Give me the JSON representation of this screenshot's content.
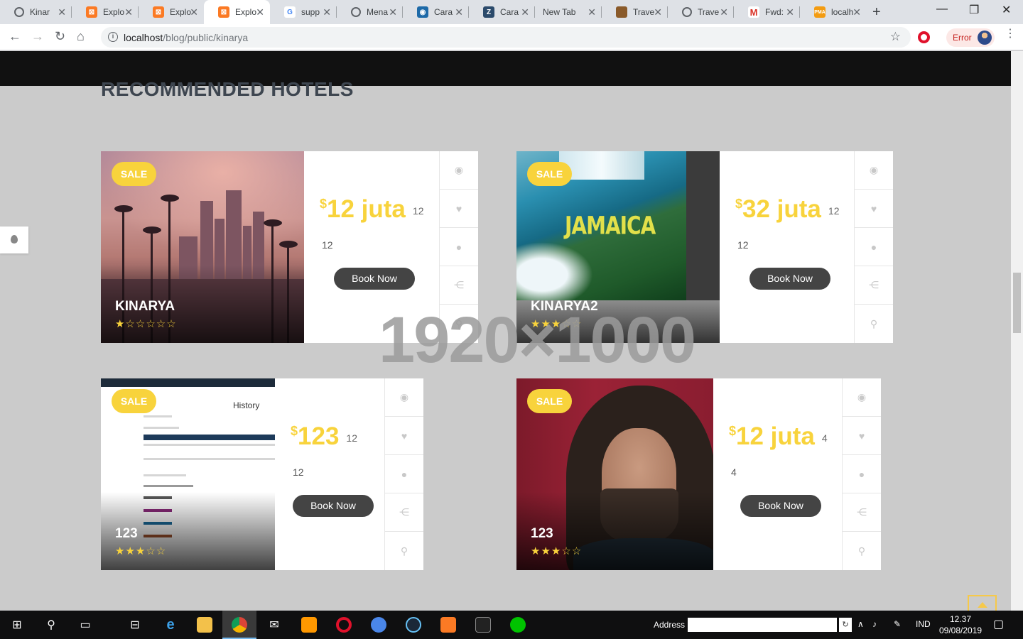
{
  "browser": {
    "tabs": [
      {
        "title": "Kinar",
        "icon": "globe-icon",
        "color": "#5f6368"
      },
      {
        "title": "Explo",
        "icon": "xampp-icon",
        "color": "#fb7a24"
      },
      {
        "title": "Explo",
        "icon": "xampp-icon",
        "color": "#fb7a24"
      },
      {
        "title": "Explo",
        "icon": "xampp-icon",
        "color": "#fb7a24",
        "active": true
      },
      {
        "title": "supp",
        "icon": "google-icon",
        "color": "#4285f4"
      },
      {
        "title": "Mena",
        "icon": "globe-icon",
        "color": "#5f6368"
      },
      {
        "title": "Cara",
        "icon": "db-icon",
        "color": "#1e6aa8"
      },
      {
        "title": "Cara",
        "icon": "zeplin-icon",
        "color": "#2b4a6b"
      },
      {
        "title": "New Tab",
        "icon": "",
        "color": ""
      },
      {
        "title": "Trave",
        "icon": "photo-icon",
        "color": "#8a5a2a"
      },
      {
        "title": "Trave",
        "icon": "globe-icon",
        "color": "#5f6368"
      },
      {
        "title": "Fwd:",
        "icon": "gmail-icon",
        "color": "#d93025"
      },
      {
        "title": "localh",
        "icon": "phpmyadmin-icon",
        "color": "#f39c12"
      }
    ],
    "url_host": "localhost",
    "url_path": "/blog/public/kinarya",
    "error_label": "Error"
  },
  "page": {
    "section_title": "RECOMMENDED HOTELS",
    "watermark": "1920×1000",
    "book_label": "Book Now",
    "sale_label": "SALE",
    "hotels": [
      {
        "name": "KINARYA",
        "price": "12 juta",
        "n1": "12",
        "n2": "12",
        "rating": 1
      },
      {
        "name": "KINARYA2",
        "price": "32 juta",
        "n1": "12",
        "n2": "12",
        "rating": 3,
        "image_text": "JAMAICA"
      },
      {
        "name": "123",
        "price": "123",
        "n1": "12",
        "n2": "12",
        "rating": 3,
        "image_text": "History"
      },
      {
        "name": "123",
        "price": "12 juta",
        "n1": "4",
        "n2": "4",
        "rating": 3
      }
    ],
    "currency": "$",
    "accent": "#f8d33c"
  },
  "taskbar": {
    "address_label": "Address",
    "lang": "IND",
    "time": "12.37",
    "date": "09/08/2019"
  }
}
